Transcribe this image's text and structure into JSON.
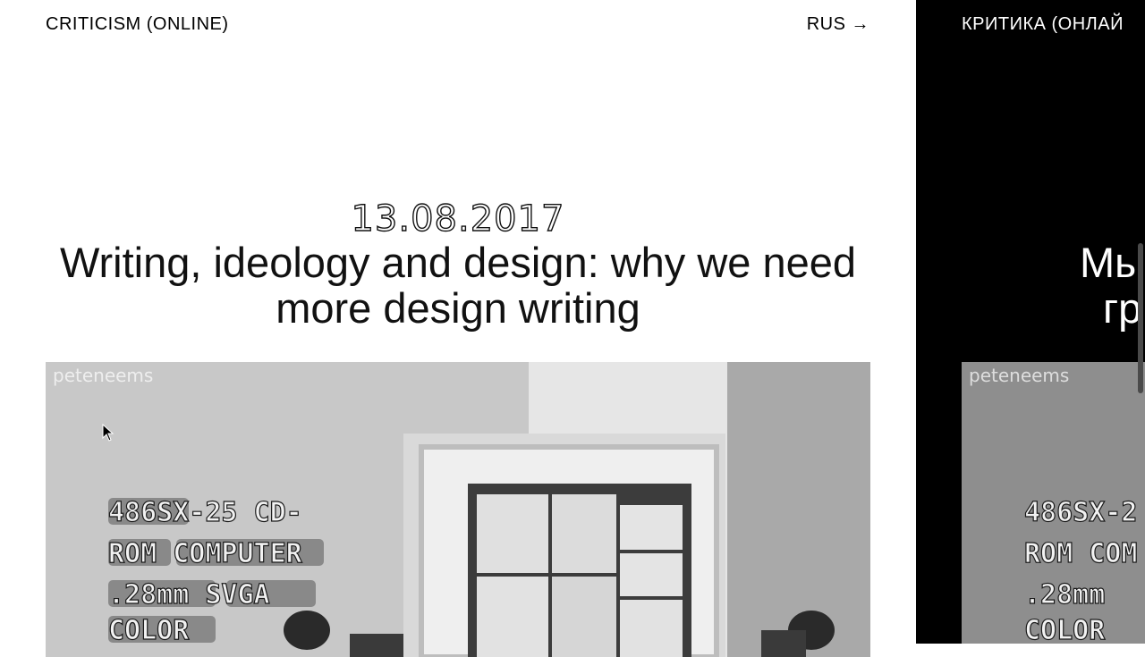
{
  "header": {
    "site_title": "CRITICISM (ONLINE)",
    "lang_switch": "RUS →"
  },
  "post": {
    "date": "13.08.2017",
    "title": "Writing, ideology and design: why we need more design writing",
    "image": {
      "watermark": "peteneems",
      "sign_lines": [
        "486SX-25 CD-",
        "ROM COMPUTER",
        ".28mm SVGA",
        "COLOR"
      ]
    }
  },
  "ru_panel": {
    "site_title": "КРИТИКА (ОНЛАЙ",
    "heading_lines": [
      "Мы",
      "гр"
    ],
    "image": {
      "watermark": "peteneems",
      "sign_lines": [
        "486SX-2",
        "ROM COM",
        ".28mm",
        "COLOR"
      ]
    }
  }
}
